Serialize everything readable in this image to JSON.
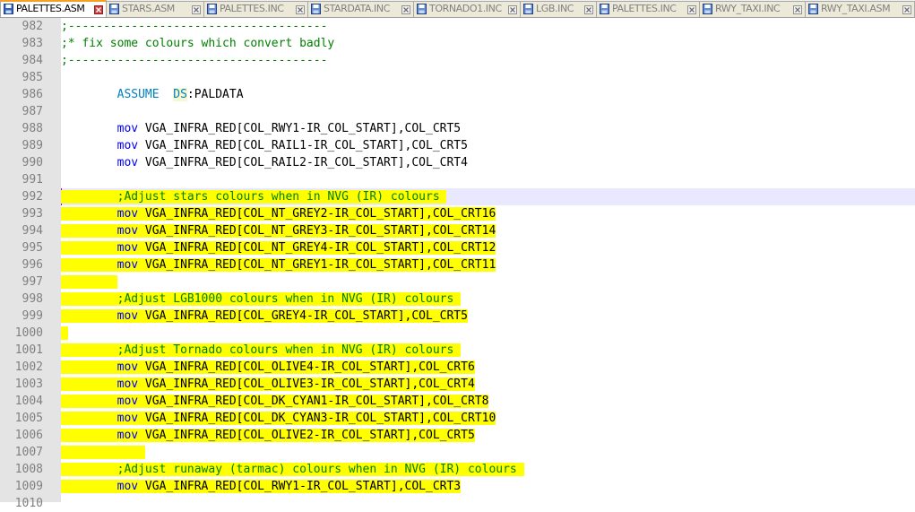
{
  "tabs": [
    {
      "label": "PALETTES.ASM",
      "active": true
    },
    {
      "label": "STARS.ASM",
      "active": false
    },
    {
      "label": "PALETTES.INC",
      "active": false
    },
    {
      "label": "STARDATA.INC",
      "active": false
    },
    {
      "label": "TORNADO1.INC",
      "active": false
    },
    {
      "label": "LGB.INC",
      "active": false
    },
    {
      "label": "PALETTES.INC",
      "active": false
    },
    {
      "label": "RWY_TAXI.INC",
      "active": false
    },
    {
      "label": "RWY_TAXI.ASM",
      "active": false
    }
  ],
  "editor": {
    "current_line": "992",
    "lines": [
      {
        "num": "982",
        "indent": "",
        "tokens": [
          {
            "t": ";-------------------------------------",
            "c": "comment"
          }
        ]
      },
      {
        "num": "983",
        "indent": "",
        "tokens": [
          {
            "t": ";* fix some colours which convert badly",
            "c": "comment"
          }
        ]
      },
      {
        "num": "984",
        "indent": "",
        "tokens": [
          {
            "t": ";-------------------------------------",
            "c": "comment"
          }
        ]
      },
      {
        "num": "985",
        "indent": "",
        "tokens": []
      },
      {
        "num": "986",
        "indent": "        ",
        "tokens": [
          {
            "t": "ASSUME",
            "c": "dir"
          },
          {
            "t": "  ",
            "c": ""
          },
          {
            "t": "DS",
            "c": "reg"
          },
          {
            "t": ":PALDATA",
            "c": ""
          }
        ]
      },
      {
        "num": "987",
        "indent": "",
        "tokens": []
      },
      {
        "num": "988",
        "indent": "        ",
        "tokens": [
          {
            "t": "mov",
            "c": "kw"
          },
          {
            "t": " VGA_INFRA_RED[COL_RWY1-IR_COL_START],COL_CRT5",
            "c": ""
          }
        ]
      },
      {
        "num": "989",
        "indent": "        ",
        "tokens": [
          {
            "t": "mov",
            "c": "kw"
          },
          {
            "t": " VGA_INFRA_RED[COL_RAIL1-IR_COL_START],COL_CRT5",
            "c": ""
          }
        ]
      },
      {
        "num": "990",
        "indent": "        ",
        "tokens": [
          {
            "t": "mov",
            "c": "kw"
          },
          {
            "t": " VGA_INFRA_RED[COL_RAIL2-IR_COL_START],COL_CRT4",
            "c": ""
          }
        ]
      },
      {
        "num": "991",
        "indent": "",
        "tokens": []
      },
      {
        "num": "992",
        "indent": "        ",
        "hl": true,
        "tokens": [
          {
            "t": ";Adjust stars colours when in NVG (IR) colours ",
            "c": "comment"
          }
        ]
      },
      {
        "num": "993",
        "indent": "        ",
        "hl": true,
        "tokens": [
          {
            "t": "mov",
            "c": "kw"
          },
          {
            "t": " VGA_INFRA_RED[COL_NT_GREY2-IR_COL_START],COL_CRT16",
            "c": ""
          }
        ]
      },
      {
        "num": "994",
        "indent": "        ",
        "hl": true,
        "tokens": [
          {
            "t": "mov",
            "c": "kw"
          },
          {
            "t": " VGA_INFRA_RED[COL_NT_GREY3-IR_COL_START],COL_CRT14",
            "c": ""
          }
        ]
      },
      {
        "num": "995",
        "indent": "        ",
        "hl": true,
        "tokens": [
          {
            "t": "mov",
            "c": "kw"
          },
          {
            "t": " VGA_INFRA_RED[COL_NT_GREY4-IR_COL_START],COL_CRT12",
            "c": ""
          }
        ]
      },
      {
        "num": "996",
        "indent": "        ",
        "hl": true,
        "tokens": [
          {
            "t": "mov",
            "c": "kw"
          },
          {
            "t": " VGA_INFRA_RED[COL_NT_GREY1-IR_COL_START],COL_CRT11",
            "c": ""
          }
        ]
      },
      {
        "num": "997",
        "indent": "        ",
        "hl": true,
        "tokens": []
      },
      {
        "num": "998",
        "indent": "        ",
        "hl": true,
        "tokens": [
          {
            "t": ";Adjust LGB1000 colours when in NVG (IR) colours ",
            "c": "comment"
          }
        ]
      },
      {
        "num": "999",
        "indent": "        ",
        "hl": true,
        "tokens": [
          {
            "t": "mov",
            "c": "kw"
          },
          {
            "t": " VGA_INFRA_RED[COL_GREY4-IR_COL_START],COL_CRT5",
            "c": ""
          }
        ]
      },
      {
        "num": "1000",
        "indent": " ",
        "hl": true,
        "tokens": []
      },
      {
        "num": "1001",
        "indent": "        ",
        "hl": true,
        "tokens": [
          {
            "t": ";Adjust Tornado colours when in NVG (IR) colours ",
            "c": "comment"
          }
        ]
      },
      {
        "num": "1002",
        "indent": "        ",
        "hl": true,
        "tokens": [
          {
            "t": "mov",
            "c": "kw"
          },
          {
            "t": " VGA_INFRA_RED[COL_OLIVE4-IR_COL_START],COL_CRT6",
            "c": ""
          }
        ]
      },
      {
        "num": "1003",
        "indent": "        ",
        "hl": true,
        "tokens": [
          {
            "t": "mov",
            "c": "kw"
          },
          {
            "t": " VGA_INFRA_RED[COL_OLIVE3-IR_COL_START],COL_CRT4",
            "c": ""
          }
        ]
      },
      {
        "num": "1004",
        "indent": "        ",
        "hl": true,
        "tokens": [
          {
            "t": "mov",
            "c": "kw"
          },
          {
            "t": " VGA_INFRA_RED[COL_DK_CYAN1-IR_COL_START],COL_CRT8",
            "c": ""
          }
        ]
      },
      {
        "num": "1005",
        "indent": "        ",
        "hl": true,
        "tokens": [
          {
            "t": "mov",
            "c": "kw"
          },
          {
            "t": " VGA_INFRA_RED[COL_DK_CYAN3-IR_COL_START],COL_CRT10",
            "c": ""
          }
        ]
      },
      {
        "num": "1006",
        "indent": "        ",
        "hl": true,
        "tokens": [
          {
            "t": "mov",
            "c": "kw"
          },
          {
            "t": " VGA_INFRA_RED[COL_OLIVE2-IR_COL_START],COL_CRT5",
            "c": ""
          }
        ]
      },
      {
        "num": "1007",
        "indent": "            ",
        "hl": true,
        "tokens": []
      },
      {
        "num": "1008",
        "indent": "        ",
        "hl": true,
        "tokens": [
          {
            "t": ";Adjust runaway (tarmac) colours when in NVG (IR) colours ",
            "c": "comment"
          }
        ]
      },
      {
        "num": "1009",
        "indent": "        ",
        "hl": true,
        "tokens": [
          {
            "t": "mov",
            "c": "kw"
          },
          {
            "t": " VGA_INFRA_RED[COL_RWY1-IR_COL_START],COL_CRT3",
            "c": ""
          }
        ]
      },
      {
        "num": "1010",
        "indent": "",
        "tokens": []
      }
    ]
  }
}
